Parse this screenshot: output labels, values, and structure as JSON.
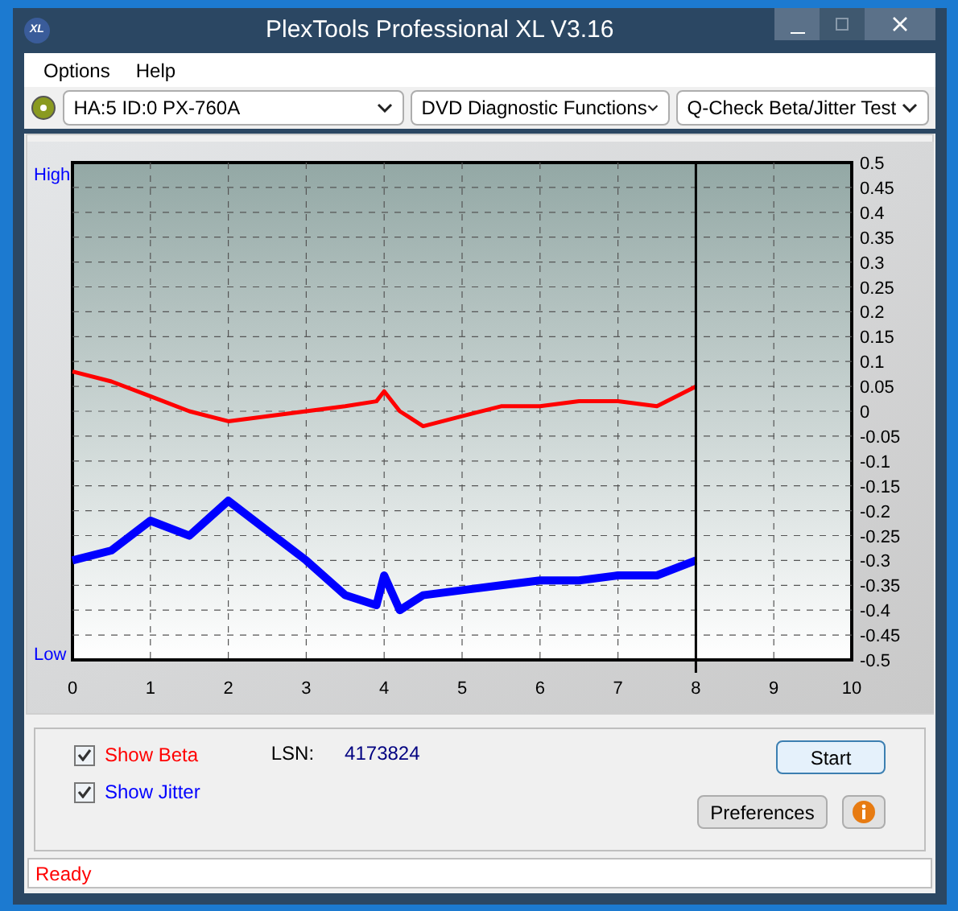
{
  "window": {
    "title": "PlexTools Professional XL V3.16",
    "app_icon": "XL"
  },
  "menu": [
    {
      "label": "Options"
    },
    {
      "label": "Help"
    }
  ],
  "toolbar": {
    "drive": "HA:5 ID:0  PX-760A",
    "function": "DVD Diagnostic Functions",
    "test": "Q-Check Beta/Jitter Test"
  },
  "chart": {
    "high_label": "High",
    "low_label": "Low",
    "chart_data": {
      "type": "line",
      "grid": true,
      "ref_lines": [
        {
          "axis": "x",
          "value": 8,
          "color": "#000000"
        }
      ],
      "x": [
        0,
        0.5,
        1,
        1.5,
        2,
        2.5,
        3,
        3.5,
        3.9,
        4,
        4.2,
        4.5,
        5,
        5.5,
        6,
        6.5,
        7,
        7.5,
        8
      ],
      "xlim": [
        0,
        10
      ],
      "ylim": [
        -0.5,
        0.5
      ],
      "xticks": [
        0,
        1,
        2,
        3,
        4,
        5,
        6,
        7,
        8,
        9,
        10
      ],
      "yticks": [
        {
          "value": 0.5,
          "label": "0.5"
        },
        {
          "value": 0.45,
          "label": "0.45"
        },
        {
          "value": 0.4,
          "label": "0.4"
        },
        {
          "value": 0.35,
          "label": "0.35"
        },
        {
          "value": 0.3,
          "label": "0.3"
        },
        {
          "value": 0.25,
          "label": "0.25"
        },
        {
          "value": 0.2,
          "label": "0.2"
        },
        {
          "value": 0.15,
          "label": "0.15"
        },
        {
          "value": 0.1,
          "label": "0.1"
        },
        {
          "value": 0.05,
          "label": "0.05"
        },
        {
          "value": 0,
          "label": "0"
        },
        {
          "value": -0.05,
          "label": "-0.05"
        },
        {
          "value": -0.1,
          "label": "-0.1"
        },
        {
          "value": -0.15,
          "label": "-0.15"
        },
        {
          "value": -0.2,
          "label": "-0.2"
        },
        {
          "value": -0.25,
          "label": "-0.25"
        },
        {
          "value": -0.3,
          "label": "-0.3"
        },
        {
          "value": -0.35,
          "label": "-0.35"
        },
        {
          "value": -0.4,
          "label": "-0.4"
        },
        {
          "value": -0.45,
          "label": "-0.45"
        },
        {
          "value": -0.5,
          "label": "-0.5"
        }
      ],
      "series": [
        {
          "color": "#ff0000",
          "values": [
            0.08,
            0.06,
            0.03,
            0.0,
            -0.02,
            -0.01,
            0.0,
            0.01,
            0.02,
            0.04,
            0.0,
            -0.03,
            -0.01,
            0.01,
            0.01,
            0.02,
            0.02,
            0.01,
            0.05
          ]
        },
        {
          "color": "#0000ff",
          "values": [
            -0.3,
            -0.28,
            -0.22,
            -0.25,
            -0.18,
            -0.24,
            -0.3,
            -0.37,
            -0.39,
            -0.33,
            -0.4,
            -0.37,
            -0.36,
            -0.35,
            -0.34,
            -0.34,
            -0.33,
            -0.33,
            -0.3
          ]
        }
      ]
    }
  },
  "options": [
    {
      "label": "Show Beta",
      "checked": true,
      "color": "#ff0000"
    },
    {
      "label": "Show Jitter",
      "checked": true,
      "color": "#0000ff"
    }
  ],
  "lsn": {
    "label": "LSN:",
    "value": "4173824"
  },
  "buttons": {
    "start": "Start",
    "preferences": "Preferences"
  },
  "status": "Ready"
}
